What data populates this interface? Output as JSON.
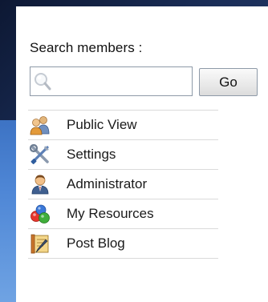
{
  "search": {
    "label": "Search members :",
    "value": "",
    "placeholder": "",
    "button_label": "Go"
  },
  "menu": {
    "items": [
      {
        "label": "Public View",
        "icon": "users-icon"
      },
      {
        "label": "Settings",
        "icon": "settings-tools-icon"
      },
      {
        "label": "Administrator",
        "icon": "administrator-icon"
      },
      {
        "label": "My Resources",
        "icon": "resources-icon"
      },
      {
        "label": "Post Blog",
        "icon": "post-blog-icon"
      }
    ]
  }
}
